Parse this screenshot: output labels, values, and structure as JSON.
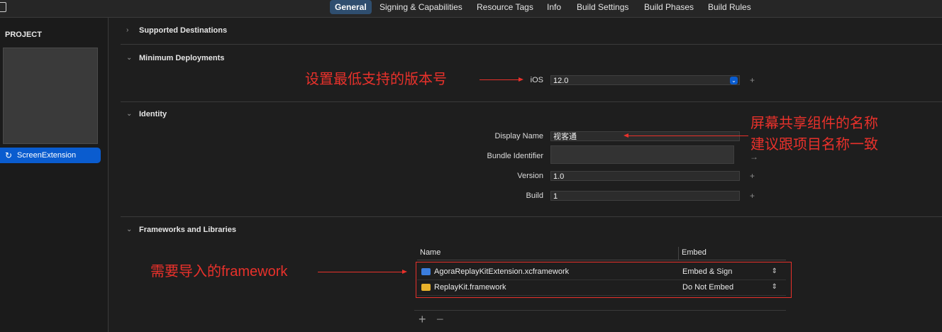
{
  "tabs": [
    "General",
    "Signing & Capabilities",
    "Resource Tags",
    "Info",
    "Build Settings",
    "Build Phases",
    "Build Rules"
  ],
  "sidebar": {
    "header": "PROJECT",
    "target": "ScreenExtension"
  },
  "sections": {
    "supported": "Supported Destinations",
    "deployments": "Minimum Deployments",
    "identity": "Identity",
    "frameworks": "Frameworks and Libraries"
  },
  "deployment": {
    "label": "iOS",
    "value": "12.0"
  },
  "identity": {
    "display_name_label": "Display Name",
    "display_name": "视客通",
    "bundle_label": "Bundle Identifier",
    "bundle": "",
    "version_label": "Version",
    "version": "1.0",
    "build_label": "Build",
    "build": "1"
  },
  "table": {
    "col_name": "Name",
    "col_embed": "Embed",
    "rows": [
      {
        "name": "AgoraReplayKitExtension.xcframework",
        "embed": "Embed & Sign",
        "icon": "xcframework-icon",
        "color": "#3b7ddd"
      },
      {
        "name": "ReplayKit.framework",
        "embed": "Do Not Embed",
        "icon": "framework-icon",
        "color": "#e8b12b"
      }
    ],
    "add": "+",
    "remove": "−"
  },
  "annotations": {
    "min_version": "设置最低支持的版本号",
    "display_name_1": "屏幕共享组件的名称",
    "display_name_2": "建议跟项目名称一致",
    "frameworks": "需要导入的framework"
  },
  "colors": {
    "accent": "#0a5ccf",
    "annotation": "#e8312b"
  }
}
